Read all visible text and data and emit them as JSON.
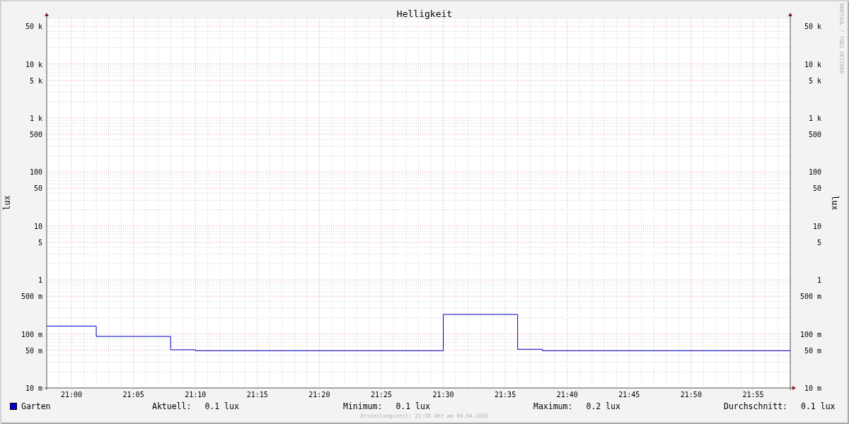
{
  "chart": {
    "title": "Helligkeit",
    "ylabel": "lux",
    "y2label": "lux",
    "x_labels": [
      "21:00",
      "21:05",
      "21:10",
      "21:15",
      "21:20",
      "21:25",
      "21:30",
      "21:35",
      "21:40",
      "21:45",
      "21:50",
      "21:55"
    ],
    "y_labels": [
      "50 k",
      "10 k",
      "5 k",
      "1 k",
      "500",
      "100",
      "50",
      "10",
      "5",
      "1",
      "500 m",
      "100 m",
      "50 m",
      "10 m"
    ],
    "y2_labels": [
      "50 k",
      "10 k",
      "5 k",
      "1 k",
      "500",
      "100",
      "50",
      "10",
      "5",
      "1",
      "500 m",
      "100 m",
      "50 m",
      "10 m"
    ],
    "legend": {
      "name": "Garten"
    }
  },
  "credit": "RRDTOOL / TOBI OETIKER",
  "stats": [
    {
      "label": "Aktuell:",
      "value": "0.1 lux"
    },
    {
      "label": "Minimum:",
      "value": "0.1 lux"
    },
    {
      "label": "Maximum:",
      "value": "0.2 lux"
    },
    {
      "label": "Durchschnitt:",
      "value": "0.1 lux"
    }
  ],
  "footer": "Erstellungszeit: 21:58 Uhr am 09.04.2026"
}
